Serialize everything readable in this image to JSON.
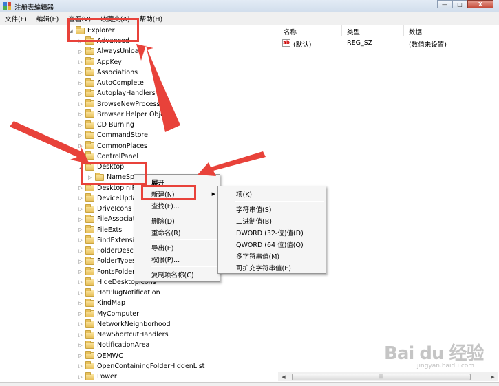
{
  "window": {
    "title": "注册表编辑器",
    "min_btn": "—",
    "max_btn": "□",
    "close_btn": "X"
  },
  "menubar": [
    "文件(F)",
    "编辑(E)",
    "查看(V)",
    "收藏夹(A)",
    "帮助(H)"
  ],
  "tree": {
    "root": "Explorer",
    "children": [
      "Advanced",
      "AlwaysUnload",
      "AppKey",
      "Associations",
      "AutoComplete",
      "AutoplayHandlers",
      "BrowseNewProcess",
      "Browser Helper Objects",
      "CD Burning",
      "CommandStore",
      "CommonPlaces",
      "ControlPanel",
      "Desktop"
    ],
    "desktop_child": "NameSp",
    "after": [
      "DesktopIniP",
      "DeviceUpda",
      "DriveIcons",
      "FileAssociati",
      "FileExts",
      "FindExtensio",
      "FolderDescr",
      "FolderTypes",
      "FontsFolder",
      "HideDesktopIcons",
      "HotPlugNotification",
      "KindMap",
      "MyComputer",
      "NetworkNeighborhood",
      "NewShortcutHandlers",
      "NotificationArea",
      "OEMWC",
      "OpenContainingFolderHiddenList",
      "Power"
    ]
  },
  "list": {
    "columns": [
      "名称",
      "类型",
      "数据"
    ],
    "rows": [
      {
        "name": "(默认)",
        "type": "REG_SZ",
        "data": "(数值未设置)"
      }
    ],
    "icon_text": "ab"
  },
  "context_menu": {
    "items": [
      "展开",
      "新建(N)",
      "查找(F)...",
      "删除(D)",
      "重命名(R)",
      "导出(E)",
      "权限(P)...",
      "复制项名称(C)"
    ]
  },
  "submenu": {
    "items": [
      "项(K)",
      "字符串值(S)",
      "二进制值(B)",
      "DWORD (32-位)值(D)",
      "QWORD (64 位)值(Q)",
      "多字符串值(M)",
      "可扩充字符串值(E)"
    ]
  },
  "watermark": {
    "text": "Bai du 经验",
    "sub": "jingyan.baidu.com"
  },
  "colors": {
    "highlight": "#e8423a",
    "title_bg": "#d2deec",
    "menu_bg": "#f0f0f0"
  }
}
